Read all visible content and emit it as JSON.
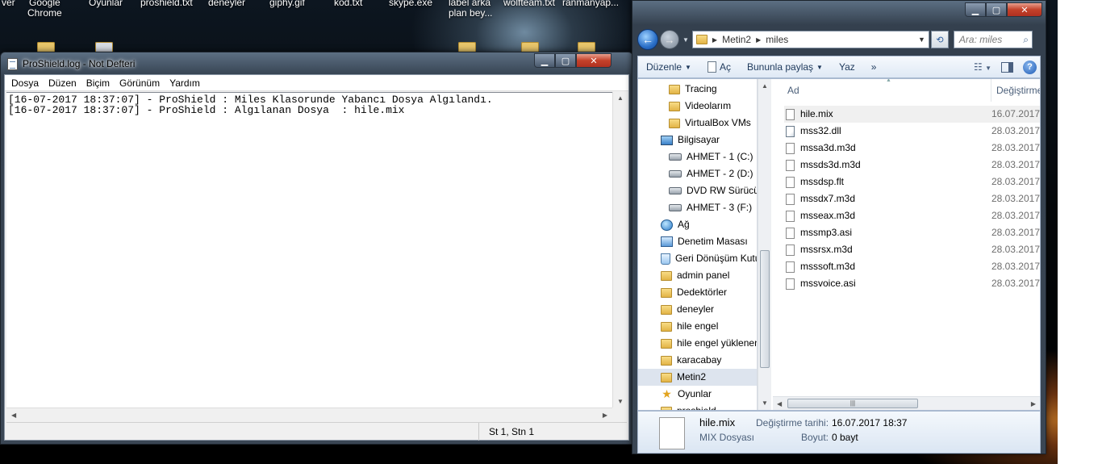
{
  "desktop": {
    "labels": [
      "ver",
      "Google\nChrome",
      "Oyunlar",
      "proshield.txt",
      "deneyler",
      "giphy.gif",
      "kod.txt",
      "skype.exe",
      "label arka\nplan bey...",
      "wolfteam.txt",
      "ranmanyap..."
    ]
  },
  "notepad": {
    "title": "ProShield.log - Not Defteri",
    "menu": [
      "Dosya",
      "Düzen",
      "Biçim",
      "Görünüm",
      "Yardım"
    ],
    "lines": [
      "[16-07-2017 18:37:07] - ProShield : Miles Klasorunde Yabancı Dosya Algılandı.",
      "[16-07-2017 18:37:07] - ProShield : Algılanan Dosya  : hile.mix"
    ],
    "status_position": "St 1, Stn 1"
  },
  "explorer": {
    "address": [
      "Metin2",
      "miles"
    ],
    "search_placeholder": "Ara: miles",
    "toolbar": {
      "organize": "Düzenle",
      "open": "Aç",
      "share": "Bununla paylaş",
      "burn": "Yaz",
      "more": "»"
    },
    "tree": [
      {
        "label": "Tracing",
        "icon": "folder-icon"
      },
      {
        "label": "Videolarım",
        "icon": "folder-icon"
      },
      {
        "label": "VirtualBox VMs",
        "icon": "folder-icon"
      },
      {
        "label": "Bilgisayar",
        "icon": "computer-icon"
      },
      {
        "label": "AHMET - 1 (C:)",
        "icon": "drive-icon"
      },
      {
        "label": "AHMET - 2 (D:)",
        "icon": "drive-icon"
      },
      {
        "label": "DVD RW Sürücüsü",
        "icon": "drive-icon"
      },
      {
        "label": "AHMET - 3 (F:)",
        "icon": "drive-icon"
      },
      {
        "label": "Ağ",
        "icon": "network-icon"
      },
      {
        "label": "Denetim Masası",
        "icon": "control-panel-icon"
      },
      {
        "label": "Geri Dönüşüm Kutusu",
        "icon": "recycle-bin-icon"
      },
      {
        "label": "admin panel",
        "icon": "folder-icon"
      },
      {
        "label": "Dedektörler",
        "icon": "folder-icon"
      },
      {
        "label": "deneyler",
        "icon": "folder-icon"
      },
      {
        "label": "hile engel",
        "icon": "folder-icon"
      },
      {
        "label": "hile engel yüklenen",
        "icon": "folder-icon"
      },
      {
        "label": "karacabay",
        "icon": "folder-icon"
      },
      {
        "label": "Metin2",
        "icon": "folder-icon"
      },
      {
        "label": "Oyunlar",
        "icon": "favorites-star-icon"
      },
      {
        "label": "proshield",
        "icon": "folder-icon"
      }
    ],
    "columns": {
      "name": "Ad",
      "modified": "Değiştirme"
    },
    "files": [
      {
        "name": "hile.mix",
        "date": "16.07.2017"
      },
      {
        "name": "mss32.dll",
        "date": "28.03.2017"
      },
      {
        "name": "mssa3d.m3d",
        "date": "28.03.2017"
      },
      {
        "name": "mssds3d.m3d",
        "date": "28.03.2017"
      },
      {
        "name": "mssdsp.flt",
        "date": "28.03.2017"
      },
      {
        "name": "mssdx7.m3d",
        "date": "28.03.2017"
      },
      {
        "name": "msseax.m3d",
        "date": "28.03.2017"
      },
      {
        "name": "mssmp3.asi",
        "date": "28.03.2017"
      },
      {
        "name": "mssrsx.m3d",
        "date": "28.03.2017"
      },
      {
        "name": "msssoft.m3d",
        "date": "28.03.2017"
      },
      {
        "name": "mssvoice.asi",
        "date": "28.03.2017"
      }
    ],
    "details": {
      "filename": "hile.mix",
      "filetype": "MIX Dosyası",
      "modified_label": "Değiştirme tarihi:",
      "modified_value": "16.07.2017 18:37",
      "size_label": "Boyut:",
      "size_value": "0 bayt"
    }
  }
}
